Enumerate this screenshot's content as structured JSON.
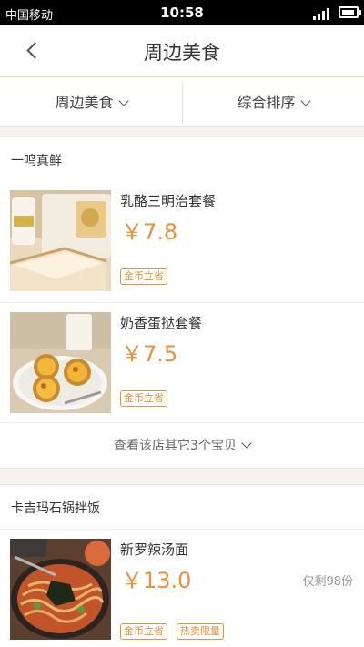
{
  "status": {
    "carrier": "中国移动",
    "time": "10:58"
  },
  "header": {
    "title": "周边美食"
  },
  "filters": [
    {
      "label": "周边美食"
    },
    {
      "label": "综合排序"
    }
  ],
  "shops": [
    {
      "name": "一鸣真鲜",
      "items": [
        {
          "name": "乳酪三明治套餐",
          "price": "￥7.8",
          "tags": [
            "金币立省"
          ]
        },
        {
          "name": "奶香蛋挞套餐",
          "price": "￥7.5",
          "tags": [
            "金币立省"
          ]
        }
      ],
      "more_label": "查看该店其它3个宝贝"
    },
    {
      "name": "卡吉玛石锅拌饭",
      "items": [
        {
          "name": "新罗辣汤面",
          "price": "￥13.0",
          "stock": "仅剩98份",
          "tags": [
            "金币立省",
            "热卖限量"
          ]
        }
      ]
    }
  ],
  "colors": {
    "accent": "#e8923a",
    "status_bar": "#000000",
    "section_gap": "#f6f4ea"
  },
  "icons": {
    "back": "chevron-left-icon",
    "dropdown": "chevron-down-icon",
    "signal": "signal-icon",
    "battery": "battery-icon"
  }
}
